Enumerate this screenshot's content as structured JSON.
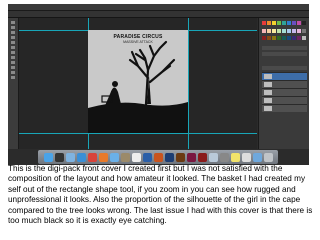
{
  "caption": "This is the digi-pack front cover I created first but I was not satisfied with the composition of the layout and how amateur it looked. The basket I had created my self out of the rectangle shape tool, if you zoom in you can see how rugged and unprofessional it looks. Also the proportion of the silhouette of the girl in the cape compared to the tree looks wrong. The last issue I had with this cover is that there is too much black so it is exactly eye catching.",
  "artwork": {
    "title": "PARADISE CIRCUS",
    "subtitle": "MASSIVE ATTACK"
  },
  "dock_icons": [
    "finder-icon",
    "dashboard-icon",
    "mail-icon",
    "safari-icon",
    "chrome-icon",
    "firefox-icon",
    "itunes-icon",
    "iphoto-icon",
    "calendar-icon",
    "word-icon",
    "powerpoint-icon",
    "photoshop-icon",
    "illustrator-icon",
    "indesign-icon",
    "flash-icon",
    "preview-icon",
    "system-prefs-icon",
    "stickies-icon",
    "textedit-icon",
    "folder-icon",
    "trash-icon"
  ],
  "colors": {
    "guide": "#18a6b8",
    "workspace": "#2b2b2b",
    "artboard": "#c9c9c9"
  }
}
